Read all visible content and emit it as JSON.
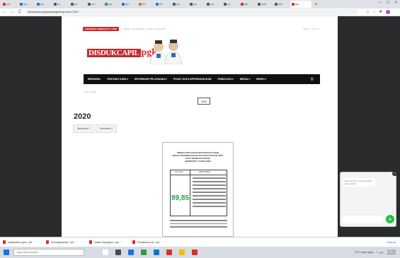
{
  "browser": {
    "tabs": [
      {
        "label": "Lam",
        "color": "#d93025"
      },
      {
        "label": "Goo",
        "color": "#1a73e8"
      },
      {
        "label": "Wo",
        "color": "#1a73e8"
      },
      {
        "label": "Un",
        "color": "#555555"
      },
      {
        "label": "Per",
        "color": "#555555"
      },
      {
        "label": "Janr",
        "color": "#555555"
      },
      {
        "label": "Ruti",
        "color": "#2e9c46"
      },
      {
        "label": "Bert",
        "color": "#1a73e8"
      },
      {
        "label": "Per",
        "color": "#e37400"
      },
      {
        "label": "DIT",
        "color": "#1a73e8"
      },
      {
        "label": "ane",
        "color": "#555555"
      },
      {
        "label": "ane",
        "color": "#555555"
      },
      {
        "label": "Fed",
        "color": "#555555"
      },
      {
        "label": "cov",
        "color": "#555555"
      },
      {
        "label": "RPL",
        "color": "#d93025"
      },
      {
        "label": "WHE",
        "color": "#555555"
      },
      {
        "label": "PDS",
        "color": "#555555"
      },
      {
        "label": "RDI",
        "color": "#d93025"
      }
    ],
    "new_tab": "+",
    "url": "disdukcapil.pangkalpinangkota.go.id/rss-2020/",
    "win_min": "–",
    "win_max": "□",
    "win_close": "×",
    "back": "←",
    "forward": "→",
    "reload": "C",
    "ext_icons": [
      "◇",
      "☆",
      "✱"
    ]
  },
  "site": {
    "date_badge": "THURSDAY, FEBRUARY 3, 2022",
    "top_links": "Sekilas · Kontak Kami · Produk Layanan DK",
    "top_right": "Sign in ·  f  ✉  ◫  ✎",
    "logo_text": "DISDUKCAPIL",
    "logo_pgk": "pgk",
    "nav": [
      "BERANDA",
      "TENTANG KAMI ▾",
      "INFORMASI PELAYANAN ▾",
      "PUSAT DATA KEPENDUDUKAN",
      "PUBLIKASI ▾",
      "MEDIA ▾",
      "NEWS ▾"
    ],
    "search_glyph": "⚲",
    "breadcrumb": "Home › 2020",
    "rss_button": "IKM",
    "page_title": "2020",
    "subtabs": [
      "Semester 1",
      "Semester 2"
    ]
  },
  "document": {
    "heading_lines": [
      "INDEKS KEPUASAN MASYARAKAT (IKM)",
      "DINAS KEPENDUDUKAN DAN PENCATATAN SIPIL",
      "KOTA PANGKALPINANG",
      "SEMESTER I TAHUN 2020"
    ],
    "col_left_header": "NILAI IKM",
    "col_right_header": "RESPONDEN",
    "score": "89,85"
  },
  "chat": {
    "message": "Hai pemohon, ada yang bisa kami bantu?",
    "send_glyph": "➤",
    "close_glyph": "×"
  },
  "downloads": [
    {
      "name": "collaborative-gove...pdf"
    },
    {
      "name": "Kemungkinankel...pdf"
    },
    {
      "name": "Kaitan Kepegawai...xlsx"
    },
    {
      "name": "Penelaman-Kak...pdf"
    }
  ],
  "downloads_caret": "^",
  "downloads_show_all": "Show all",
  "taskbar": {
    "search_placeholder": "Type here to search",
    "apps": [
      {
        "color": "#ffffff"
      },
      {
        "color": "#4a4a4a"
      },
      {
        "color": "#1a73e8"
      },
      {
        "color": "#2e9c46"
      },
      {
        "color": "#0078d4"
      },
      {
        "color": "#d93025"
      },
      {
        "color": "#ffb900"
      },
      {
        "color": "#d93025"
      }
    ],
    "weather": "29°C Hujan ringan",
    "tray_icons": "^ ◐ ◢ ◁",
    "time": "9:41 AM",
    "date": "2/3/2022"
  }
}
